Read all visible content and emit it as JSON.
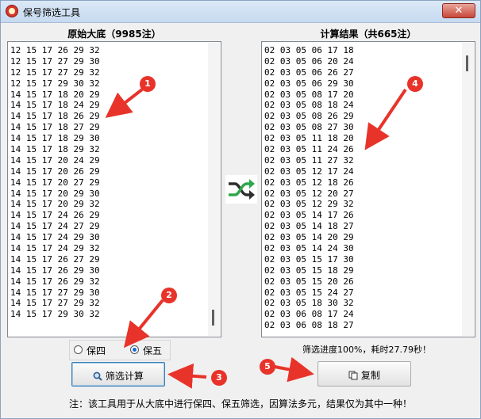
{
  "window": {
    "title": "保号筛选工具",
    "close_label": "✕"
  },
  "left_panel": {
    "heading": "原始大底（9985注）",
    "rows": [
      "12 15 17 26 29 32",
      "12 15 17 27 29 30",
      "12 15 17 27 29 32",
      "12 15 17 29 30 32",
      "14 15 17 18 20 29",
      "14 15 17 18 24 29",
      "14 15 17 18 26 29",
      "14 15 17 18 27 29",
      "14 15 17 18 29 30",
      "14 15 17 18 29 32",
      "14 15 17 20 24 29",
      "14 15 17 20 26 29",
      "14 15 17 20 27 29",
      "14 15 17 20 29 30",
      "14 15 17 20 29 32",
      "14 15 17 24 26 29",
      "14 15 17 24 27 29",
      "14 15 17 24 29 30",
      "14 15 17 24 29 32",
      "14 15 17 26 27 29",
      "14 15 17 26 29 30",
      "14 15 17 26 29 32",
      "14 15 17 27 29 30",
      "14 15 17 27 29 32",
      "14 15 17 29 30 32"
    ]
  },
  "right_panel": {
    "heading": "计算结果（共665注）",
    "rows": [
      "02 03 05 06 17 18",
      "02 03 05 06 20 24",
      "02 03 05 06 26 27",
      "02 03 05 06 29 30",
      "02 03 05 08 17 20",
      "02 03 05 08 18 24",
      "02 03 05 08 26 29",
      "02 03 05 08 27 30",
      "02 03 05 11 18 20",
      "02 03 05 11 24 26",
      "02 03 05 11 27 32",
      "02 03 05 12 17 24",
      "02 03 05 12 18 26",
      "02 03 05 12 20 27",
      "02 03 05 12 29 32",
      "02 03 05 14 17 26",
      "02 03 05 14 18 27",
      "02 03 05 14 20 29",
      "02 03 05 14 24 30",
      "02 03 05 15 17 30",
      "02 03 05 15 18 29",
      "02 03 05 15 20 26",
      "02 03 05 15 24 27",
      "02 03 05 18 30 32",
      "02 03 06 08 17 24",
      "02 03 06 08 18 27"
    ]
  },
  "options": {
    "bao4": "保四",
    "bao5": "保五",
    "selected": "bao5"
  },
  "buttons": {
    "compute": "筛选计算",
    "copy": "复制"
  },
  "status": {
    "progress": "筛选进度100%，耗时27.79秒！"
  },
  "footer": {
    "note": "注：该工具用于从大底中进行保四、保五筛选，因算法多元，结果仅为其中一种！"
  },
  "callouts": [
    "1",
    "2",
    "3",
    "4",
    "5"
  ],
  "colors": {
    "callout": "#e8332a",
    "accent": "#1a6ad8"
  }
}
